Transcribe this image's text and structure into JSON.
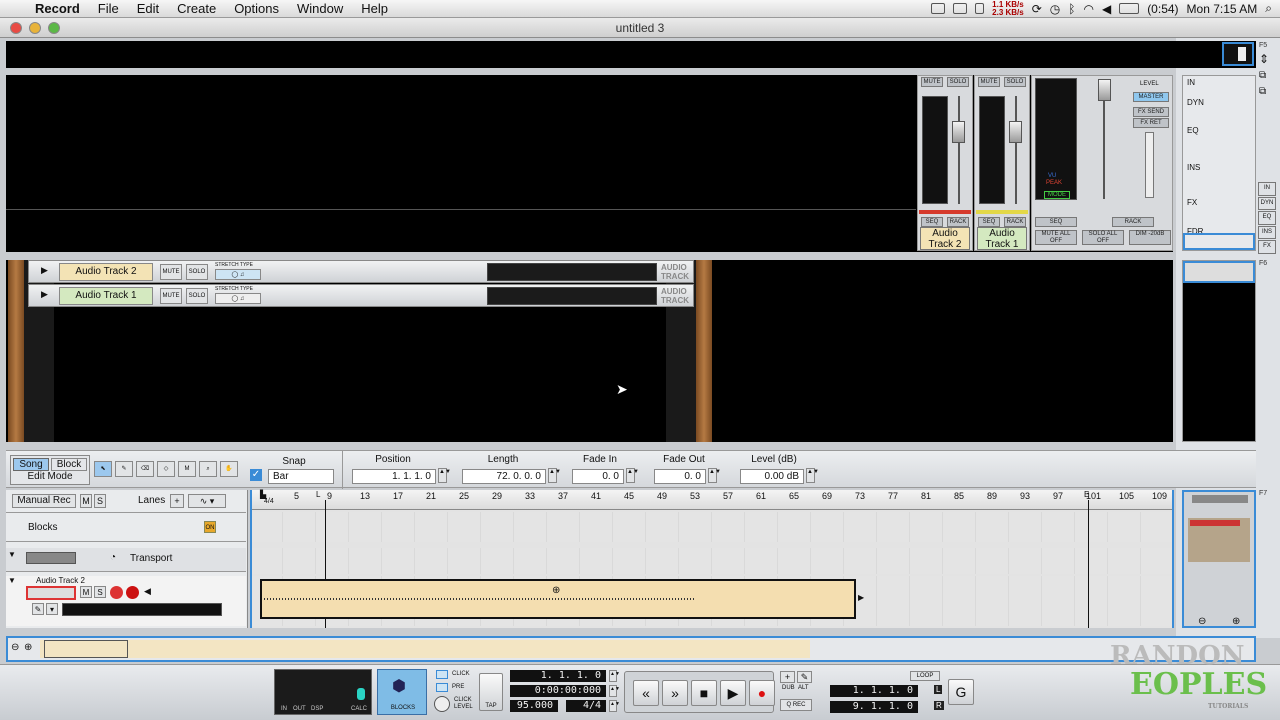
{
  "menubar": {
    "app": "Record",
    "items": [
      "File",
      "Edit",
      "Create",
      "Options",
      "Window",
      "Help"
    ],
    "net_up": "1.1 KB/s",
    "net_down": "2.3 KB/s",
    "battery": "(0:54)",
    "clock": "Mon 7:15 AM"
  },
  "window": {
    "title": "untitled 3"
  },
  "fkeys": {
    "f5": "F5",
    "f6": "F6",
    "f7": "F7"
  },
  "mixer": {
    "mute": "MUTE",
    "solo": "SOLO",
    "seq": "SEQ",
    "rack": "RACK",
    "track2_name": "Audio Track 2",
    "track1_name": "Audio Track 1",
    "master": {
      "level": "LEVEL",
      "master_btn": "MASTER",
      "fx_send": "FX SEND",
      "fx_ret": "FX RET",
      "vu": "VU",
      "peak": "PEAK",
      "mode": "MODE",
      "mute_all": "MUTE ALL OFF",
      "solo_all": "SOLO ALL OFF",
      "dim": "DIM -20dB"
    },
    "sections": [
      "IN",
      "DYN",
      "EQ",
      "INS",
      "FX",
      "FDR"
    ],
    "mini_sections": [
      "IN",
      "DYN",
      "EQ",
      "INS",
      "FX",
      "FDR"
    ]
  },
  "rack": {
    "tracks": [
      {
        "name": "Audio Track 2",
        "color": "#f3e3b5",
        "mute": "MUTE",
        "solo": "SOLO",
        "stretch": "STRETCH TYPE",
        "device": "AUDIO TRACK"
      },
      {
        "name": "Audio Track 1",
        "color": "#d4e9c0",
        "mute": "MUTE",
        "solo": "SOLO",
        "stretch": "STRETCH TYPE",
        "device": "AUDIO TRACK"
      }
    ]
  },
  "toolbar": {
    "song": "Song",
    "block": "Block",
    "edit_mode": "Edit Mode",
    "snap_label": "Snap",
    "snap_value": "Bar",
    "position_label": "Position",
    "position_value": "1.  1.  1.    0",
    "length_label": "Length",
    "length_value": "72.  0.  0.    0",
    "fadein_label": "Fade In",
    "fadein_value": "0.    0",
    "fadeout_label": "Fade Out",
    "fadeout_value": "0.    0",
    "level_label": "Level (dB)",
    "level_value": "0.00 dB"
  },
  "sequencer": {
    "manual_rec": "Manual Rec",
    "m": "M",
    "s": "S",
    "lanes": "Lanes",
    "blocks": "Blocks",
    "on": "ON",
    "transport": "Transport",
    "track_name": "Audio Track 2",
    "ruler": [
      "5",
      "9",
      "13",
      "17",
      "21",
      "25",
      "29",
      "33",
      "37",
      "41",
      "45",
      "49",
      "53",
      "57",
      "61",
      "65",
      "69",
      "73",
      "77",
      "81",
      "85",
      "89",
      "93",
      "97",
      "101",
      "105",
      "109"
    ],
    "sig": "4/4"
  },
  "transport": {
    "in": "IN",
    "out": "OUT",
    "dsp": "DSP",
    "calc": "CALC",
    "blocks": "BLOCKS",
    "click": "CLICK",
    "pre": "PRE",
    "click_level": "CLICK LEVEL",
    "tap": "TAP",
    "pos_bars": "1.  1.  1.    0",
    "pos_time": "0:00:00:000",
    "tempo": "95.000",
    "sig": "4/4",
    "dub": "DUB",
    "alt": "ALT",
    "qrec": "Q REC",
    "loop": "LOOP",
    "loop_l": "1.  1.  1.    0",
    "loop_r": "9.  1.  1.    0",
    "L": "L",
    "R": "R"
  },
  "watermark": {
    "line1": "RANDON",
    "line2": "EOPLES",
    "sub": "TUTORIALS"
  }
}
